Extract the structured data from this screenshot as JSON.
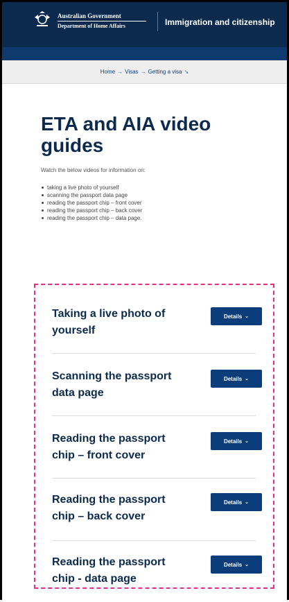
{
  "header": {
    "gov_line1": "Australian Government",
    "gov_line2": "Department of Home Affairs",
    "title": "Immigration and citizenship",
    "bg_color": "#0b2a4e"
  },
  "breadcrumb": {
    "items": [
      "Home",
      "Visas",
      "Getting a visa"
    ],
    "separator": "→",
    "dropdown_glyph": "↘"
  },
  "main": {
    "title": "ETA and AIA video guides",
    "intro": "Watch the below videos for information on:",
    "bullets": [
      "taking a live photo of yourself",
      "scanning the passport data page",
      "reading the passport chip – front cover",
      "reading the passport chip – back cover",
      "reading the passport chip – data page."
    ]
  },
  "accordion": {
    "highlight_color": "#e2308a",
    "button_label": "Details",
    "button_chevron": "⌄",
    "items": [
      {
        "title": "Taking a live photo of yourself"
      },
      {
        "title": "Scanning the passport data page"
      },
      {
        "title": "Reading the passport chip – front cover"
      },
      {
        "title": "Reading the passport chip – back cover"
      },
      {
        "title": "Reading the passport chip - data page"
      }
    ]
  }
}
